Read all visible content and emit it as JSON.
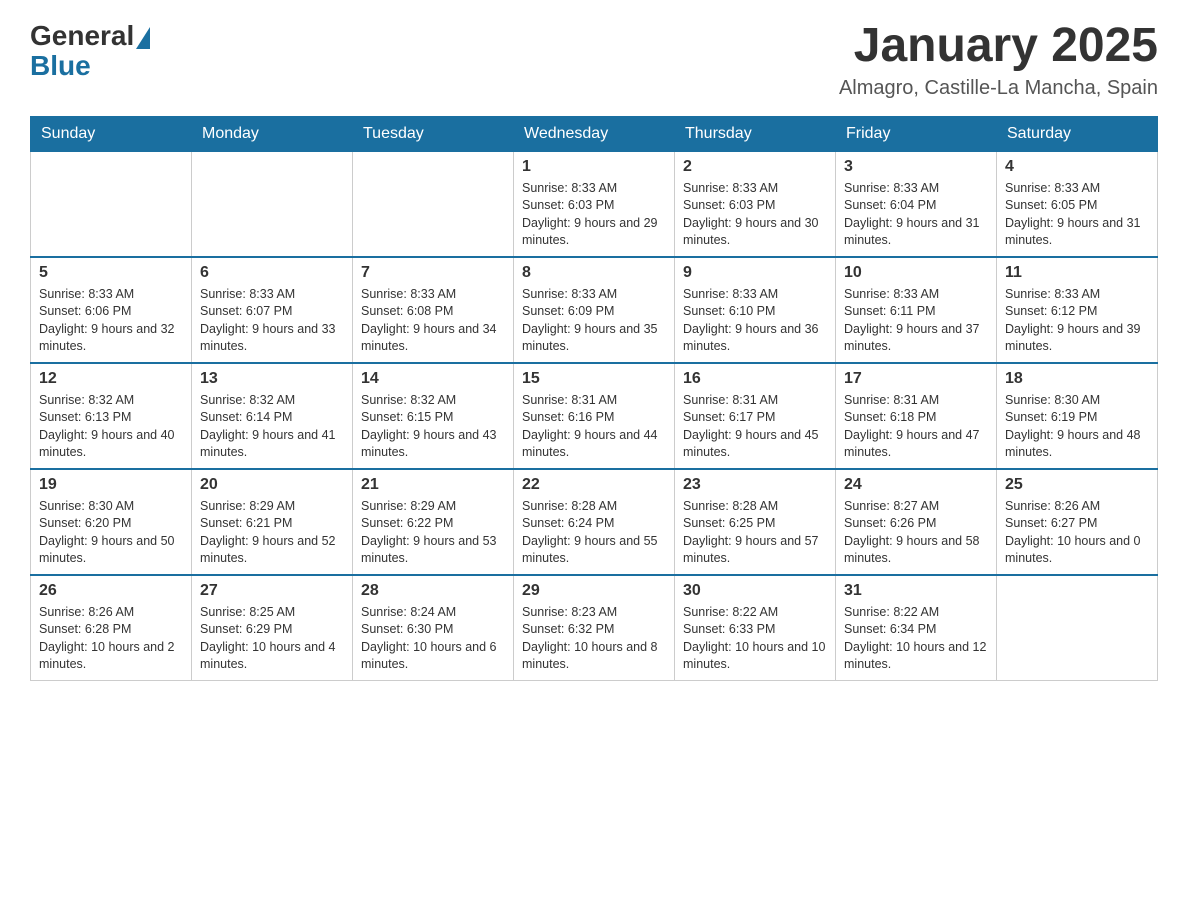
{
  "header": {
    "logo_general": "General",
    "logo_blue": "Blue",
    "month_title": "January 2025",
    "location": "Almagro, Castille-La Mancha, Spain"
  },
  "weekdays": [
    "Sunday",
    "Monday",
    "Tuesday",
    "Wednesday",
    "Thursday",
    "Friday",
    "Saturday"
  ],
  "weeks": [
    [
      {
        "day": "",
        "info": ""
      },
      {
        "day": "",
        "info": ""
      },
      {
        "day": "",
        "info": ""
      },
      {
        "day": "1",
        "info": "Sunrise: 8:33 AM\nSunset: 6:03 PM\nDaylight: 9 hours and 29 minutes."
      },
      {
        "day": "2",
        "info": "Sunrise: 8:33 AM\nSunset: 6:03 PM\nDaylight: 9 hours and 30 minutes."
      },
      {
        "day": "3",
        "info": "Sunrise: 8:33 AM\nSunset: 6:04 PM\nDaylight: 9 hours and 31 minutes."
      },
      {
        "day": "4",
        "info": "Sunrise: 8:33 AM\nSunset: 6:05 PM\nDaylight: 9 hours and 31 minutes."
      }
    ],
    [
      {
        "day": "5",
        "info": "Sunrise: 8:33 AM\nSunset: 6:06 PM\nDaylight: 9 hours and 32 minutes."
      },
      {
        "day": "6",
        "info": "Sunrise: 8:33 AM\nSunset: 6:07 PM\nDaylight: 9 hours and 33 minutes."
      },
      {
        "day": "7",
        "info": "Sunrise: 8:33 AM\nSunset: 6:08 PM\nDaylight: 9 hours and 34 minutes."
      },
      {
        "day": "8",
        "info": "Sunrise: 8:33 AM\nSunset: 6:09 PM\nDaylight: 9 hours and 35 minutes."
      },
      {
        "day": "9",
        "info": "Sunrise: 8:33 AM\nSunset: 6:10 PM\nDaylight: 9 hours and 36 minutes."
      },
      {
        "day": "10",
        "info": "Sunrise: 8:33 AM\nSunset: 6:11 PM\nDaylight: 9 hours and 37 minutes."
      },
      {
        "day": "11",
        "info": "Sunrise: 8:33 AM\nSunset: 6:12 PM\nDaylight: 9 hours and 39 minutes."
      }
    ],
    [
      {
        "day": "12",
        "info": "Sunrise: 8:32 AM\nSunset: 6:13 PM\nDaylight: 9 hours and 40 minutes."
      },
      {
        "day": "13",
        "info": "Sunrise: 8:32 AM\nSunset: 6:14 PM\nDaylight: 9 hours and 41 minutes."
      },
      {
        "day": "14",
        "info": "Sunrise: 8:32 AM\nSunset: 6:15 PM\nDaylight: 9 hours and 43 minutes."
      },
      {
        "day": "15",
        "info": "Sunrise: 8:31 AM\nSunset: 6:16 PM\nDaylight: 9 hours and 44 minutes."
      },
      {
        "day": "16",
        "info": "Sunrise: 8:31 AM\nSunset: 6:17 PM\nDaylight: 9 hours and 45 minutes."
      },
      {
        "day": "17",
        "info": "Sunrise: 8:31 AM\nSunset: 6:18 PM\nDaylight: 9 hours and 47 minutes."
      },
      {
        "day": "18",
        "info": "Sunrise: 8:30 AM\nSunset: 6:19 PM\nDaylight: 9 hours and 48 minutes."
      }
    ],
    [
      {
        "day": "19",
        "info": "Sunrise: 8:30 AM\nSunset: 6:20 PM\nDaylight: 9 hours and 50 minutes."
      },
      {
        "day": "20",
        "info": "Sunrise: 8:29 AM\nSunset: 6:21 PM\nDaylight: 9 hours and 52 minutes."
      },
      {
        "day": "21",
        "info": "Sunrise: 8:29 AM\nSunset: 6:22 PM\nDaylight: 9 hours and 53 minutes."
      },
      {
        "day": "22",
        "info": "Sunrise: 8:28 AM\nSunset: 6:24 PM\nDaylight: 9 hours and 55 minutes."
      },
      {
        "day": "23",
        "info": "Sunrise: 8:28 AM\nSunset: 6:25 PM\nDaylight: 9 hours and 57 minutes."
      },
      {
        "day": "24",
        "info": "Sunrise: 8:27 AM\nSunset: 6:26 PM\nDaylight: 9 hours and 58 minutes."
      },
      {
        "day": "25",
        "info": "Sunrise: 8:26 AM\nSunset: 6:27 PM\nDaylight: 10 hours and 0 minutes."
      }
    ],
    [
      {
        "day": "26",
        "info": "Sunrise: 8:26 AM\nSunset: 6:28 PM\nDaylight: 10 hours and 2 minutes."
      },
      {
        "day": "27",
        "info": "Sunrise: 8:25 AM\nSunset: 6:29 PM\nDaylight: 10 hours and 4 minutes."
      },
      {
        "day": "28",
        "info": "Sunrise: 8:24 AM\nSunset: 6:30 PM\nDaylight: 10 hours and 6 minutes."
      },
      {
        "day": "29",
        "info": "Sunrise: 8:23 AM\nSunset: 6:32 PM\nDaylight: 10 hours and 8 minutes."
      },
      {
        "day": "30",
        "info": "Sunrise: 8:22 AM\nSunset: 6:33 PM\nDaylight: 10 hours and 10 minutes."
      },
      {
        "day": "31",
        "info": "Sunrise: 8:22 AM\nSunset: 6:34 PM\nDaylight: 10 hours and 12 minutes."
      },
      {
        "day": "",
        "info": ""
      }
    ]
  ]
}
